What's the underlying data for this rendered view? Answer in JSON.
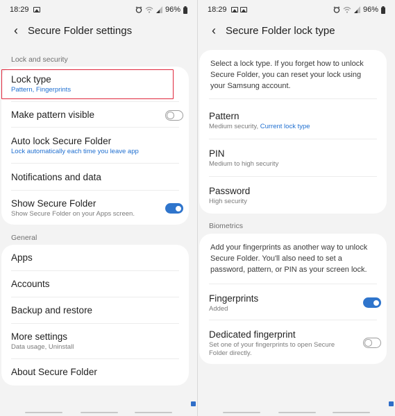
{
  "status_bar": {
    "time": "18:29",
    "battery": "96%"
  },
  "left": {
    "title": "Secure Folder settings",
    "section_lock_security": "Lock and security",
    "lock_type": {
      "label": "Lock type",
      "sub": "Pattern, Fingerprints"
    },
    "pattern_visible": {
      "label": "Make pattern visible",
      "toggle": "off"
    },
    "auto_lock": {
      "label": "Auto lock Secure Folder",
      "sub": "Lock automatically each time you leave app"
    },
    "notifications": {
      "label": "Notifications and data"
    },
    "show_folder": {
      "label": "Show Secure Folder",
      "sub": "Show Secure Folder on your Apps screen.",
      "toggle": "on"
    },
    "section_general": "General",
    "apps": {
      "label": "Apps"
    },
    "accounts": {
      "label": "Accounts"
    },
    "backup": {
      "label": "Backup and restore"
    },
    "more": {
      "label": "More settings",
      "sub": "Data usage, Uninstall"
    },
    "about": {
      "label": "About Secure Folder"
    }
  },
  "right": {
    "title": "Secure Folder lock type",
    "intro": "Select a lock type. If you forget how to unlock Secure Folder, you can reset your lock using your Samsung account.",
    "pattern": {
      "label": "Pattern",
      "sub": "Medium security, ",
      "sub_current": "Current lock type"
    },
    "pin": {
      "label": "PIN",
      "sub": "Medium to high security"
    },
    "password": {
      "label": "Password",
      "sub": "High security"
    },
    "section_biometrics": "Biometrics",
    "bio_intro": "Add your fingerprints as another way to unlock Secure Folder. You'll also need to set a password, pattern, or PIN as your screen lock.",
    "fingerprints": {
      "label": "Fingerprints",
      "sub": "Added",
      "toggle": "on"
    },
    "dedicated": {
      "label": "Dedicated fingerprint",
      "sub": "Set one of your fingerprints to open Secure Folder directly.",
      "toggle": "off"
    }
  },
  "colors": {
    "accent": "#2f75cc",
    "highlight": "#e0263b",
    "link": "#1f6fd0",
    "background": "#f3f3f3"
  },
  "icons": {
    "back": "chevron-left-icon",
    "gallery": "image-icon",
    "alarm": "alarm-icon",
    "wifi": "wifi-icon",
    "signal": "signal-icon",
    "battery": "battery-icon"
  }
}
